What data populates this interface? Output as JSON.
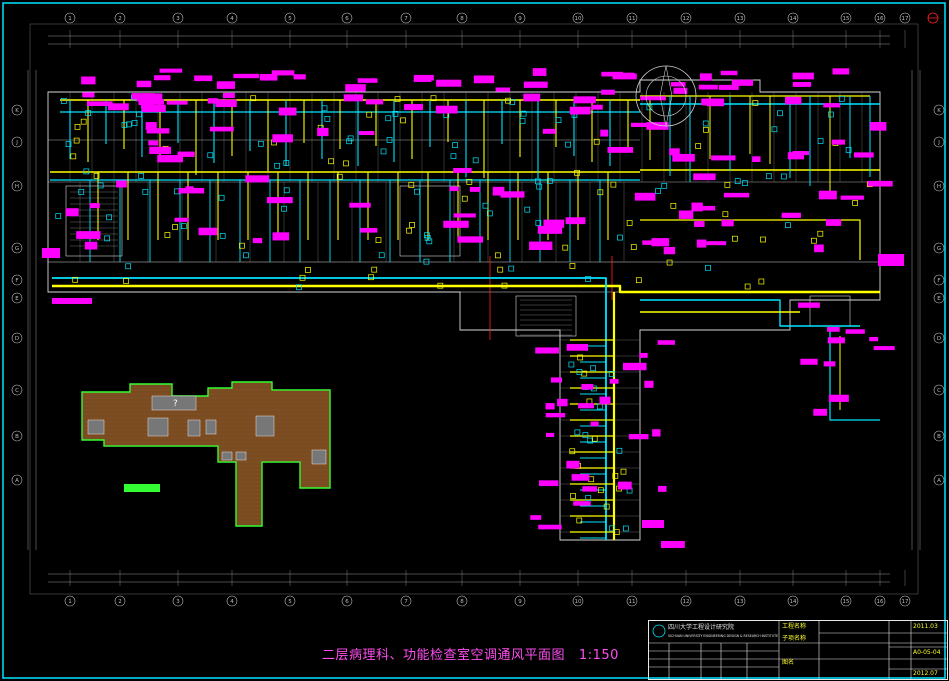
{
  "drawing": {
    "title": "二层病理科、功能检查室空调通风平面图",
    "scale": "1:150",
    "annex_label": "?"
  },
  "grid": {
    "column_labels": [
      "1",
      "2",
      "3",
      "4",
      "5",
      "6",
      "7",
      "8",
      "9",
      "10",
      "11",
      "12",
      "13",
      "14",
      "15",
      "16",
      "17"
    ],
    "row_labels": [
      "K",
      "J",
      "H",
      "G",
      "F",
      "E",
      "D",
      "C",
      "B",
      "A"
    ]
  },
  "title_block": {
    "company_cn": "四川大学工程设计研究院",
    "company_en": "SICHUAN UNIVERSITY ENGINEERING DESIGN & RESEARCH INSTITUTE",
    "project_no": "2011.03",
    "drawing_no": "A0-05-04",
    "date": "2012.07",
    "project_name_label": "工程名称",
    "sub_label": "子项名称",
    "drawing_name_label": "图名"
  },
  "colors": {
    "frame": "#00e5ff",
    "duct_yellow": "#ffff00",
    "duct_cyan": "#00e5ff",
    "label_magenta": "#ff00ff",
    "wall_white": "#d8d8d8",
    "brick": "#7a4a20",
    "outline_green": "#33ff33",
    "red_line": "#ff2020"
  }
}
